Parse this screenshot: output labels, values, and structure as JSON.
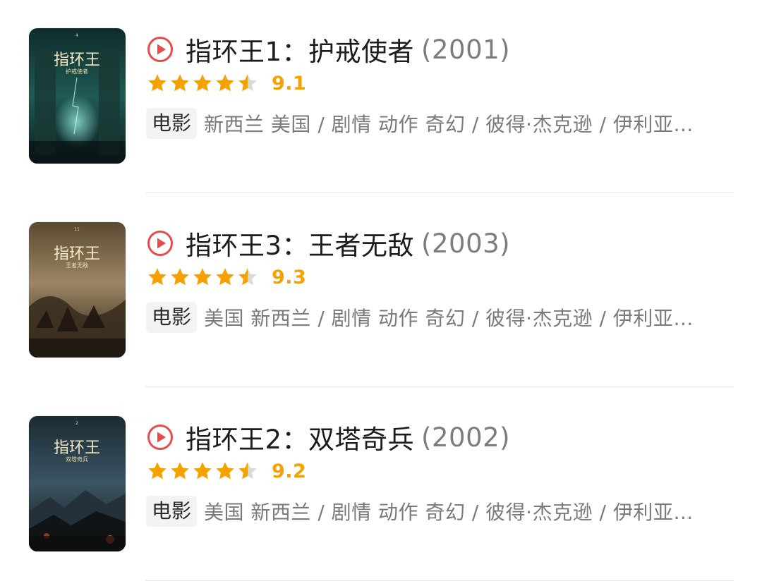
{
  "colors": {
    "accent_star": "#f5a100",
    "play_icon": "#e94b4b",
    "star_empty": "#d9d9d9"
  },
  "items": [
    {
      "title": "指环王1：护戒使者",
      "year": "(2001)",
      "rating": 4.5,
      "score": "9.1",
      "badge": "电影",
      "meta": "新西兰 美国 / 剧情 动作 奇幻 / 彼得·杰克逊 / 伊利亚…",
      "poster": {
        "title": "指环王",
        "subtitle": "护戒使者",
        "theme": "teal"
      }
    },
    {
      "title": "指环王3：王者无敌",
      "year": "(2003)",
      "rating": 4.5,
      "score": "9.3",
      "badge": "电影",
      "meta": "美国 新西兰 / 剧情 动作 奇幻 / 彼得·杰克逊 / 伊利亚…",
      "poster": {
        "title": "指环王",
        "subtitle": "王者无敌",
        "theme": "sepia"
      }
    },
    {
      "title": "指环王2：双塔奇兵",
      "year": "(2002)",
      "rating": 4.5,
      "score": "9.2",
      "badge": "电影",
      "meta": "美国 新西兰 / 剧情 动作 奇幻 / 彼得·杰克逊 / 伊利亚…",
      "poster": {
        "title": "指环王",
        "subtitle": "双塔奇兵",
        "theme": "stormy"
      }
    }
  ]
}
